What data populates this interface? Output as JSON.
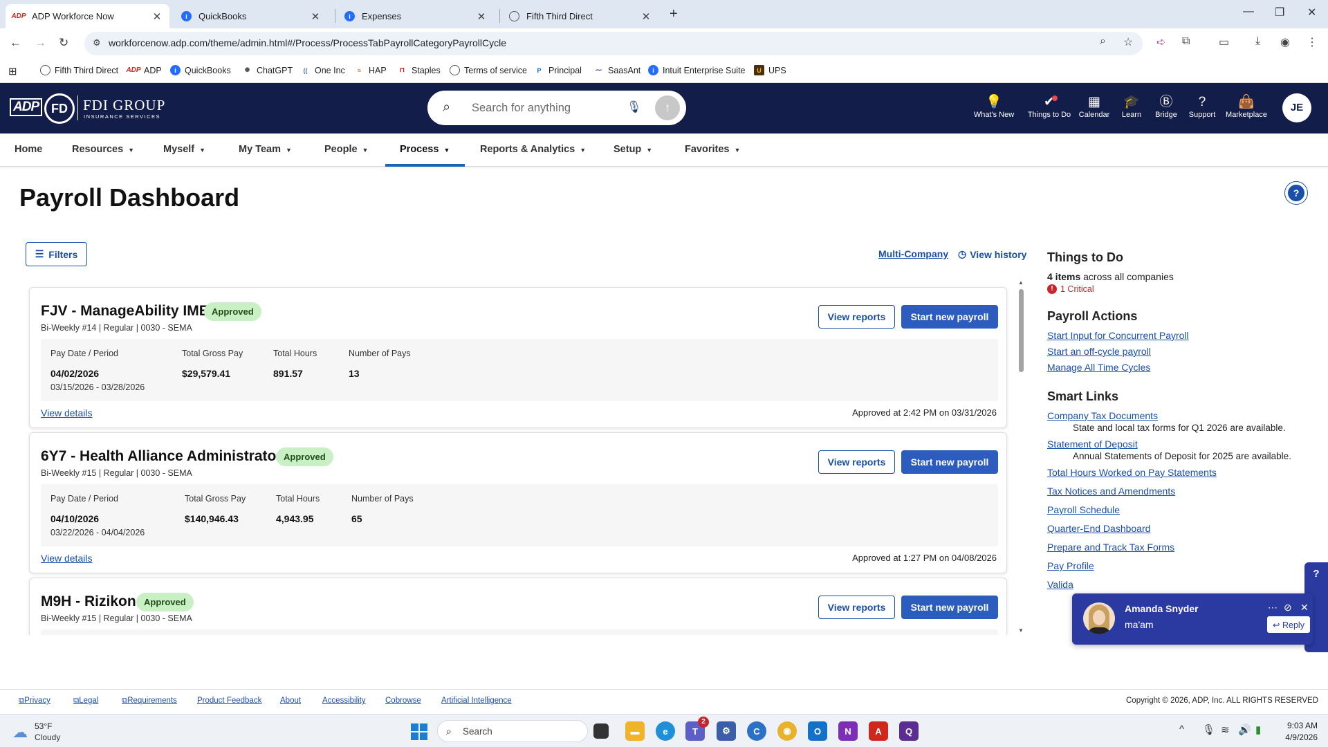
{
  "browser": {
    "tabs": [
      {
        "title": "ADP Workforce Now",
        "icon": "adp-logo-icon"
      },
      {
        "title": "QuickBooks",
        "icon": "quickbooks-icon"
      },
      {
        "title": "Expenses",
        "icon": "quickbooks-icon"
      },
      {
        "title": "Fifth Third Direct",
        "icon": "globe-icon"
      }
    ],
    "url": "workforcenow.adp.com/theme/admin.html#/Process/ProcessTabPayrollCategoryPayrollCycle",
    "bookmarks": [
      {
        "label": "Fifth Third Direct",
        "icon": "globe-icon"
      },
      {
        "label": "ADP",
        "icon": "adp-logo-icon"
      },
      {
        "label": "QuickBooks",
        "icon": "quickbooks-icon"
      },
      {
        "label": "ChatGPT",
        "icon": "chatgpt-icon"
      },
      {
        "label": "One Inc",
        "icon": "oneinc-icon"
      },
      {
        "label": "HAP",
        "icon": "hap-icon"
      },
      {
        "label": "Staples",
        "icon": "staples-icon"
      },
      {
        "label": "Terms of service",
        "icon": "globe-icon"
      },
      {
        "label": "Principal",
        "icon": "principal-icon"
      },
      {
        "label": "SaasAnt",
        "icon": "saasant-icon"
      },
      {
        "label": "Intuit Enterprise Suite",
        "icon": "quickbooks-icon"
      },
      {
        "label": "UPS",
        "icon": "ups-icon"
      }
    ]
  },
  "header": {
    "logo_text": "FDI GROUP",
    "logo_sub": "INSURANCE SERVICES",
    "search_placeholder": "Search for anything",
    "nav": [
      {
        "label": "What's New",
        "icon": "lightbulb-icon"
      },
      {
        "label": "Things to Do",
        "icon": "checkmark-badge-icon"
      },
      {
        "label": "Calendar",
        "icon": "calendar-icon"
      },
      {
        "label": "Learn",
        "icon": "graduation-cap-icon"
      },
      {
        "label": "Bridge",
        "icon": "bridge-icon"
      },
      {
        "label": "Support",
        "icon": "question-icon"
      },
      {
        "label": "Marketplace",
        "icon": "shopping-bag-icon"
      }
    ],
    "avatar_initials": "JE"
  },
  "menu": [
    "Home",
    "Resources",
    "Myself",
    "My Team",
    "People",
    "Process",
    "Reports & Analytics",
    "Setup",
    "Favorites"
  ],
  "active_menu": "Process",
  "page": {
    "title": "Payroll Dashboard",
    "filters_label": "Filters",
    "multi_company": "Multi-Company",
    "view_history": "View history"
  },
  "cards": [
    {
      "name": "FJV - ManageAbility IME",
      "status": "Approved",
      "sub": "Bi-Weekly #14 | Regular | 0030 - SEMA",
      "pay_date": "04/02/2026",
      "period": "03/15/2026 - 03/28/2026",
      "gross_pay": "$29,579.41",
      "total_hours": "891.57",
      "num_pays": "13",
      "approved_at": "Approved at 2:42 PM on 03/31/2026"
    },
    {
      "name": "6Y7 - Health Alliance Administrators",
      "status": "Approved",
      "sub": "Bi-Weekly #15 | Regular | 0030 - SEMA",
      "pay_date": "04/10/2026",
      "period": "03/22/2026 - 04/04/2026",
      "gross_pay": "$140,946.43",
      "total_hours": "4,943.95",
      "num_pays": "65",
      "approved_at": "Approved at 1:27 PM on 04/08/2026"
    },
    {
      "name": "M9H - Rizikon",
      "status": "Approved",
      "sub": "Bi-Weekly #15 | Regular | 0030 - SEMA",
      "pay_date": "",
      "period": "",
      "gross_pay": "",
      "total_hours": "",
      "num_pays": "",
      "approved_at": ""
    }
  ],
  "card_labels": {
    "view_reports": "View reports",
    "start_payroll": "Start new payroll",
    "pay_date_period": "Pay Date / Period",
    "gross_pay": "Total Gross Pay",
    "total_hours": "Total Hours",
    "num_pays": "Number of Pays",
    "view_details": "View details"
  },
  "right_panel": {
    "todo_title": "Things to Do",
    "todo_count": "4 items",
    "todo_suffix": "across all companies",
    "todo_critical": "1 Critical",
    "actions_title": "Payroll Actions",
    "actions": [
      "Start Input for Concurrent Payroll",
      "Start an off-cycle payroll",
      "Manage All Time Cycles"
    ],
    "smart_title": "Smart Links",
    "smart_links": [
      {
        "label": "Company Tax Documents",
        "note": "State and local tax forms for Q1 2026 are available."
      },
      {
        "label": "Statement of Deposit",
        "note": "Annual Statements of Deposit for 2025 are available."
      },
      {
        "label": "Total Hours Worked on Pay Statements",
        "note": ""
      },
      {
        "label": "Tax Notices and Amendments",
        "note": ""
      },
      {
        "label": "Payroll Schedule",
        "note": ""
      },
      {
        "label": "Quarter-End Dashboard",
        "note": ""
      },
      {
        "label": "Prepare and Track Tax Forms",
        "note": ""
      },
      {
        "label": "Pay Profile",
        "note": ""
      },
      {
        "label": "Valida",
        "note": ""
      }
    ]
  },
  "chat": {
    "name": "Amanda Snyder",
    "message": "ma'am",
    "reply_label": "Reply"
  },
  "footer": {
    "links": [
      "Privacy",
      "Legal",
      "Requirements",
      "Product Feedback",
      "About",
      "Accessibility",
      "Cobrowse",
      "Artificial Intelligence"
    ],
    "copyright": "Copyright © 2026, ADP, Inc. ALL RIGHTS RESERVED"
  },
  "taskbar": {
    "temperature": "53°F",
    "weather": "Cloudy",
    "search_label": "Search",
    "time": "9:03 AM",
    "date": "4/9/2026",
    "teams_badge": "2"
  },
  "colors": {
    "header_bg": "#131d4a",
    "primary": "#2d5cbf",
    "link": "#1a4fa8",
    "approved_bg": "#c9f0c4",
    "critical": "#c4262e"
  }
}
